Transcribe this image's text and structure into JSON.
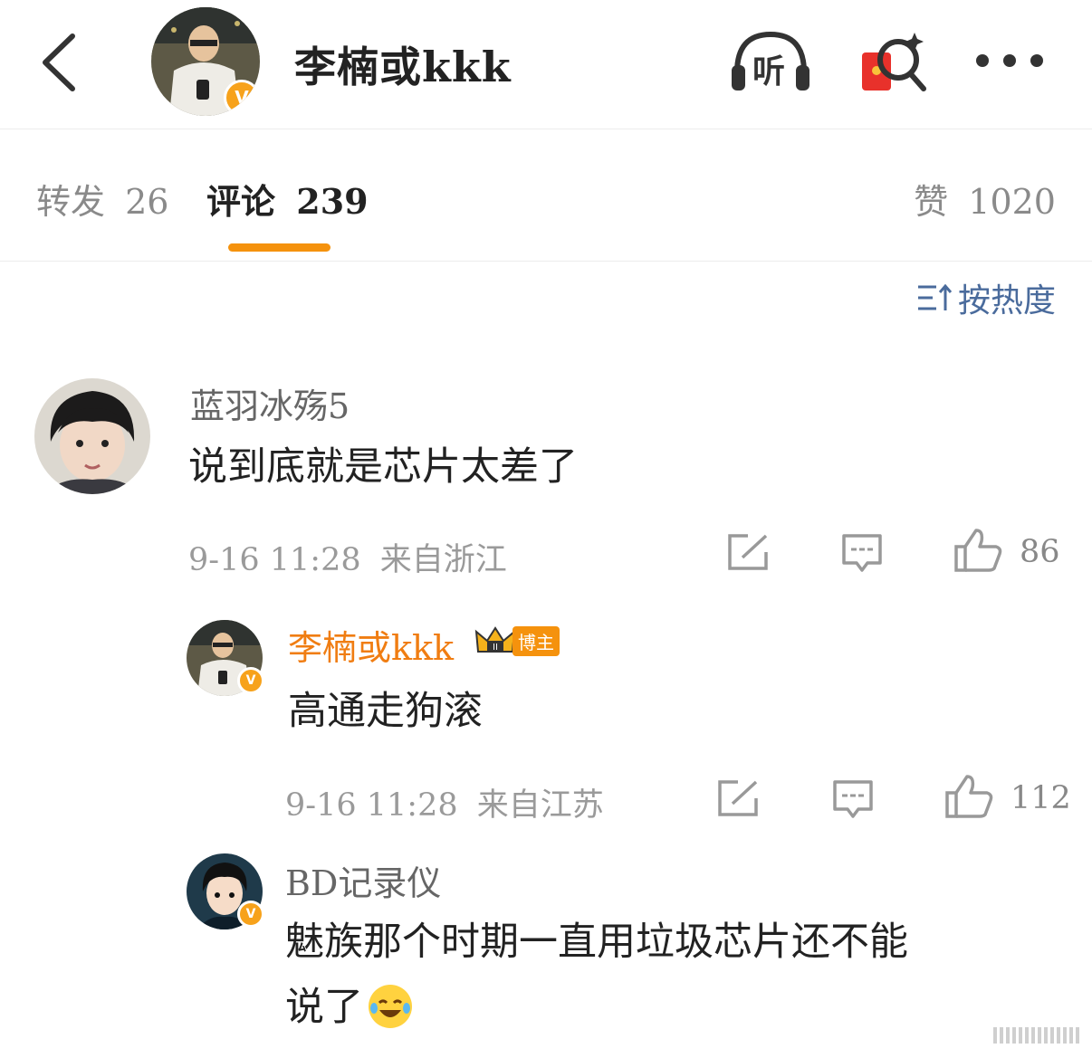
{
  "header": {
    "title": "李楠或kkk",
    "listen_label": "听",
    "icons": [
      "back-arrow-icon",
      "listen-headphones-icon",
      "red-envelope-search-icon",
      "more-dots-icon"
    ]
  },
  "tabs": {
    "repost": {
      "label": "转发",
      "count": "26"
    },
    "comment": {
      "label": "评论",
      "count": "239"
    },
    "like": {
      "label": "赞",
      "count": "1020"
    }
  },
  "sort": {
    "label": "按热度"
  },
  "comments": [
    {
      "user": "蓝羽冰殇5",
      "text": "说到底就是芯片太差了",
      "date": "9-16 11:28",
      "location": "来自浙江",
      "likes": "86"
    },
    {
      "user": "李楠或kkk",
      "badge": "博主",
      "text": "高通走狗滚",
      "date": "9-16 11:28",
      "location": "来自江苏",
      "likes": "112"
    },
    {
      "user": "BD记录仪",
      "text_line1": "魅族那个时期一直用垃圾芯片还不能",
      "text_line2": "说了"
    }
  ],
  "colors": {
    "accent": "#f5920d",
    "link_blue": "#4a6b9c",
    "vip_orange": "#f07d12"
  }
}
